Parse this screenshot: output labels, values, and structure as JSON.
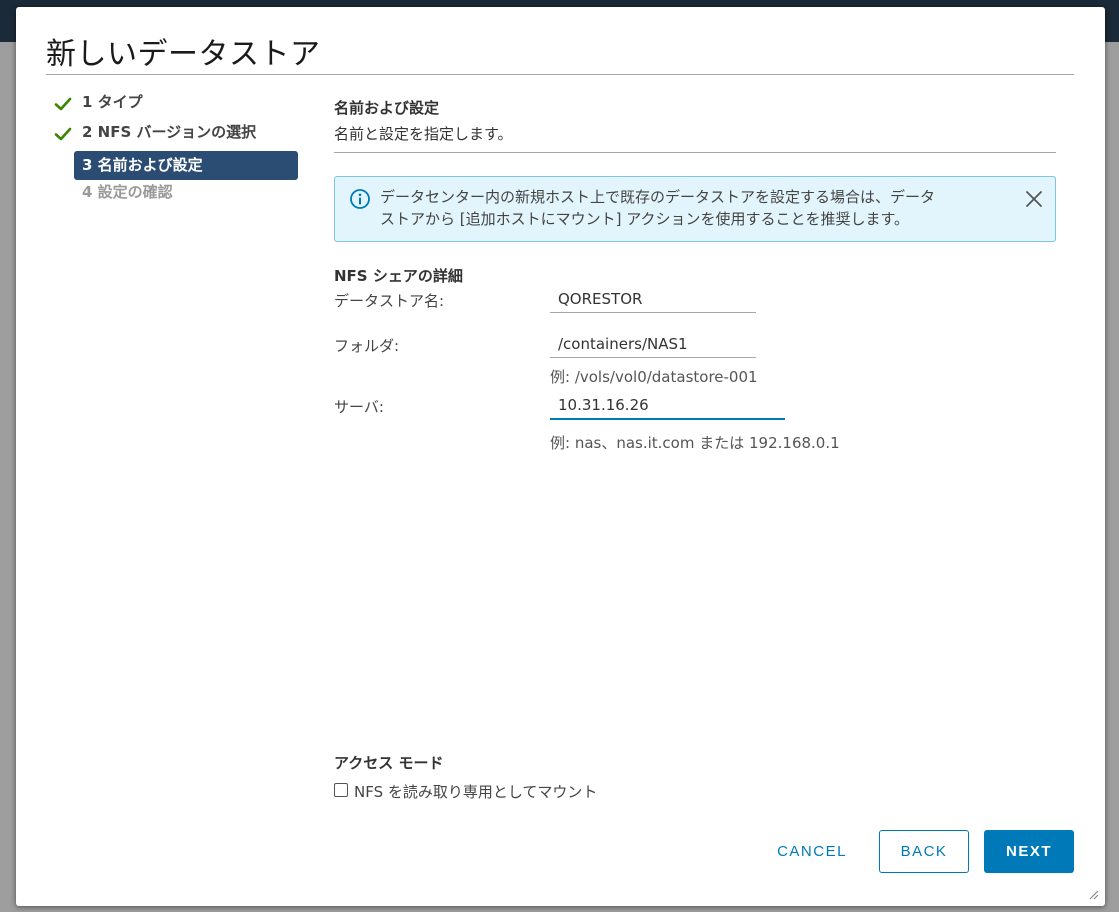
{
  "dialog": {
    "title": "新しいデータストア"
  },
  "steps": [
    {
      "label": "1 タイプ",
      "state": "done"
    },
    {
      "label": "2 NFS バージョンの選択",
      "state": "done"
    },
    {
      "label": "3 名前および設定",
      "state": "active"
    },
    {
      "label": "4 設定の確認",
      "state": "disabled"
    }
  ],
  "content": {
    "section_title": "名前および設定",
    "section_desc": "名前と設定を指定します。",
    "alert": {
      "line1": "データセンター内の新規ホスト上で既存のデータストアを設定する場合は、データ",
      "line2": "ストアから [追加ホストにマウント] アクションを使用することを推奨します。",
      "icon": "info-icon"
    },
    "nfs_title": "NFS シェアの詳細",
    "fields": {
      "datastore_name": {
        "label": "データストア名:",
        "value": "QORESTOR"
      },
      "folder": {
        "label": "フォルダ:",
        "value": "/containers/NAS1",
        "hint": "例: /vols/vol0/datastore-001"
      },
      "server": {
        "label": "サーバ:",
        "value": "10.31.16.26",
        "hint": "例: nas、nas.it.com または 192.168.0.1"
      }
    },
    "access_title": "アクセス モード",
    "readonly_label": "NFS を読み取り専用としてマウント",
    "readonly_checked": false
  },
  "buttons": {
    "cancel": "CANCEL",
    "back": "BACK",
    "next": "NEXT"
  },
  "colors": {
    "primary": "#0079b8",
    "active_step": "#2b4d73",
    "check": "#3c8500",
    "alert_bg": "#e3f5fc"
  }
}
